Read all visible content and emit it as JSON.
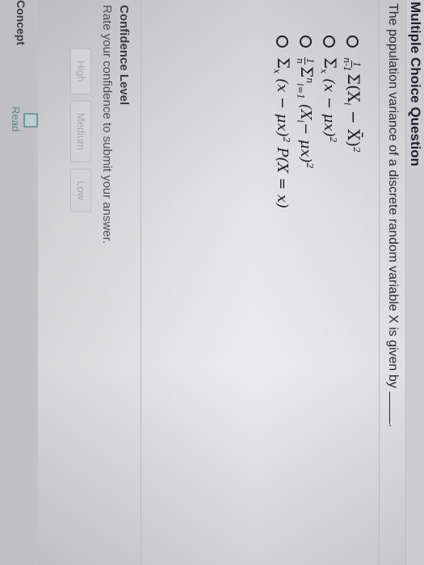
{
  "header": {
    "title": "Multiple Choice Question"
  },
  "question": {
    "text": "The population variance of a discrete random variable X is given by",
    "trailing_punctuation": "."
  },
  "options": [
    {
      "id": "a",
      "formula": "1/(n-1) Σ(Xi − X̄)²",
      "parts": {
        "num": "1",
        "den": "n-1",
        "body": "Σ(X",
        "sub": "i",
        "tail": " − X̄)",
        "sup": "2"
      }
    },
    {
      "id": "b",
      "formula": "Σx (x − μx)²",
      "parts": {
        "sigma": "Σ",
        "sub": "x",
        "body": "(x − μx)",
        "sup": "2"
      }
    },
    {
      "id": "c",
      "formula": "1/n Σi=1..n (Xi − μx)²",
      "parts": {
        "num": "1",
        "den": "n",
        "sigma": "Σ",
        "sub": "i=1",
        "sup_top": "n",
        "body": "(X",
        "body_sub": "i",
        "tail": "− μx)",
        "sup": "2"
      }
    },
    {
      "id": "d",
      "formula": "Σx (x − μx)² P(X = x)",
      "parts": {
        "sigma": "Σ",
        "sub": "x",
        "body": "(x − μx)",
        "sup": "2",
        "tail": " P(X = x)"
      }
    }
  ],
  "confidence": {
    "heading": "Confidence Level",
    "subtext": "Rate your confidence to submit your answer.",
    "buttons": [
      "High",
      "Medium",
      "Low"
    ]
  },
  "footer": {
    "concept_label": "Concept",
    "read_label": "Read"
  }
}
